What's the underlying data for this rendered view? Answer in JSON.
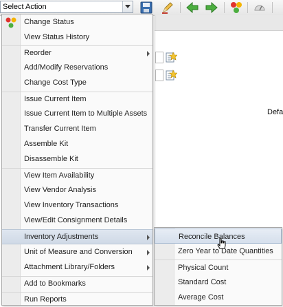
{
  "toolbar": {
    "select_action_label": "Select Action",
    "icons": [
      "save-icon",
      "edit-pencil-icon",
      "back-arrow-icon",
      "forward-arrow-icon",
      "status-icon",
      "report-icon"
    ]
  },
  "background": {
    "partial_text": "Defa"
  },
  "menu": {
    "items": [
      {
        "label": "Change Status",
        "icon": "status-change-icon"
      },
      {
        "label": "View Status History"
      },
      {
        "label": "Reorder",
        "submenu": true
      },
      {
        "label": "Add/Modify Reservations"
      },
      {
        "label": "Change Cost Type"
      },
      {
        "label": "Issue Current Item"
      },
      {
        "label": "Issue Current Item to Multiple Assets"
      },
      {
        "label": "Transfer Current Item"
      },
      {
        "label": "Assemble Kit"
      },
      {
        "label": "Disassemble Kit"
      },
      {
        "label": "View Item Availability"
      },
      {
        "label": "View Vendor Analysis"
      },
      {
        "label": "View Inventory Transactions"
      },
      {
        "label": "View/Edit Consignment Details"
      },
      {
        "label": "Inventory Adjustments",
        "submenu": true,
        "active": true
      },
      {
        "label": "Unit of Measure and Conversion",
        "submenu": true
      },
      {
        "label": "Attachment Library/Folders",
        "submenu": true
      },
      {
        "label": "Add to Bookmarks"
      },
      {
        "label": "Run Reports"
      }
    ]
  },
  "submenu": {
    "items": [
      {
        "label": "Reconcile Balances",
        "hover": true
      },
      {
        "label": "Zero Year to Date Quantities"
      },
      {
        "label": "Physical Count"
      },
      {
        "label": "Standard Cost"
      },
      {
        "label": "Average Cost"
      }
    ]
  }
}
